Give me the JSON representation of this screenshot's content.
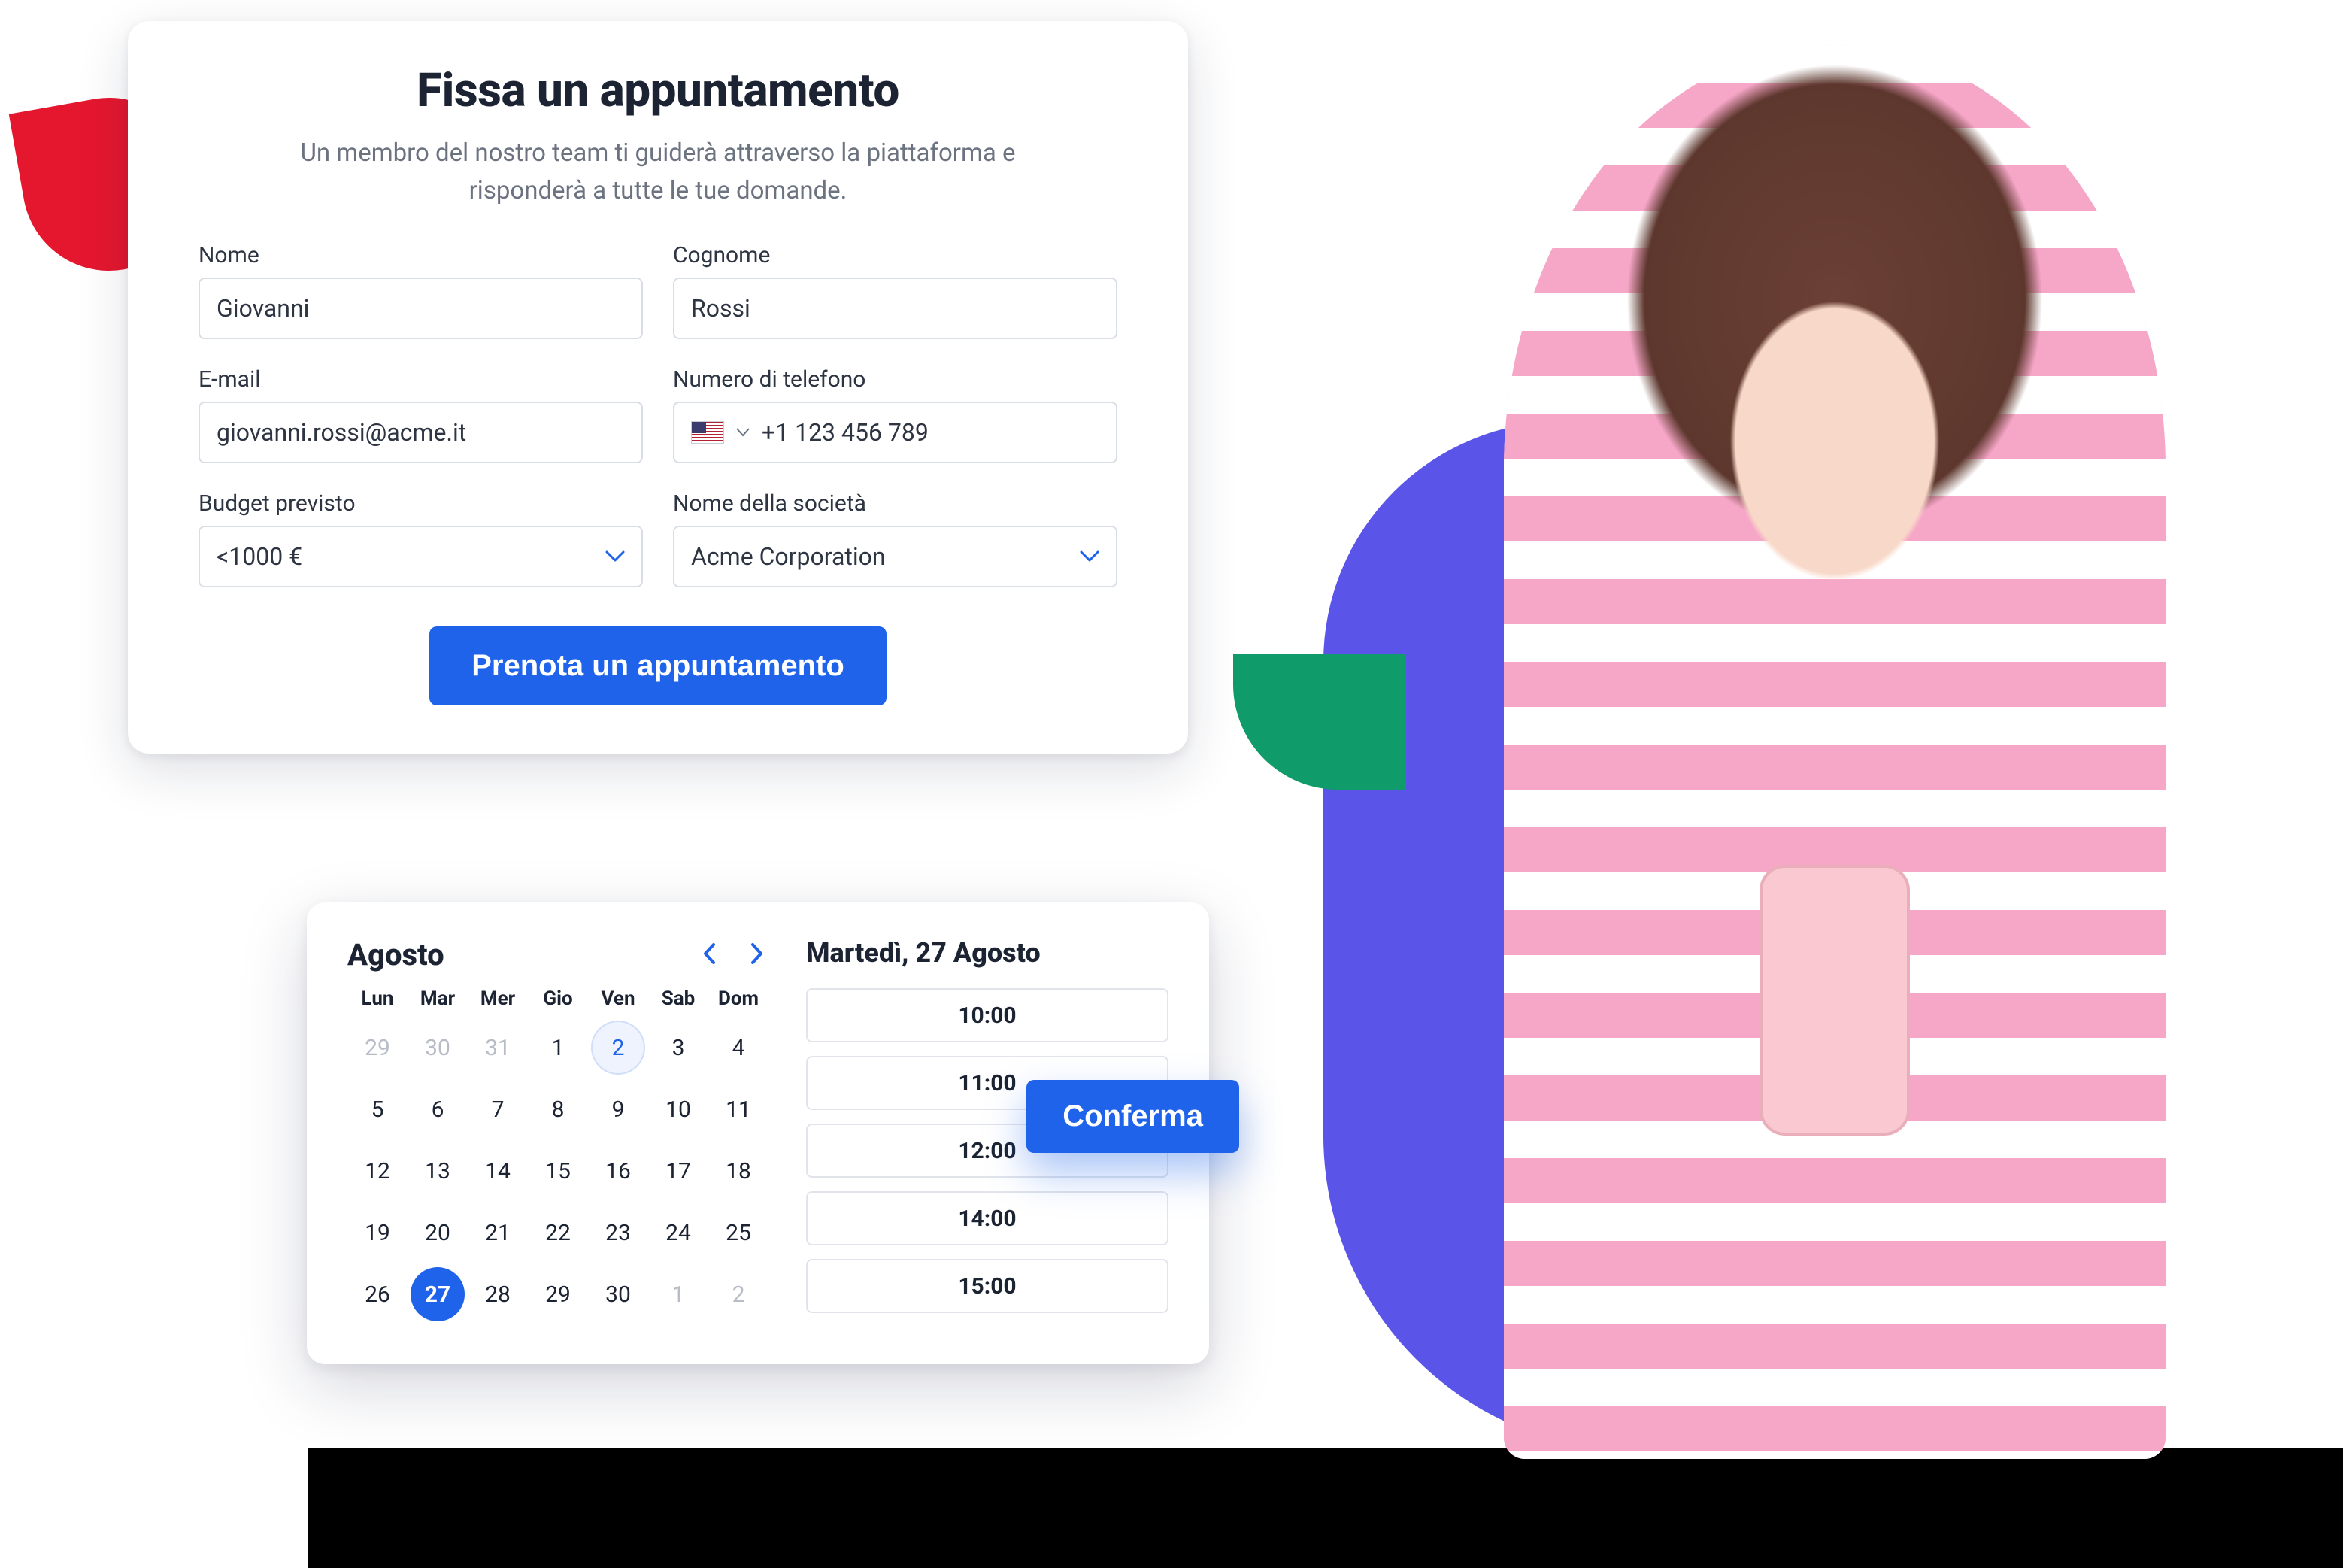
{
  "colors": {
    "accent": "#1e63e9",
    "red": "#e5172f",
    "green": "#0f9b6a",
    "purple": "#5b54e8"
  },
  "form": {
    "title": "Fissa un appuntamento",
    "subtitle": "Un membro del nostro team ti guiderà attraverso la piattaforma e risponderà a tutte le tue domande.",
    "fields": {
      "first_name": {
        "label": "Nome",
        "value": "Giovanni"
      },
      "last_name": {
        "label": "Cognome",
        "value": "Rossi"
      },
      "email": {
        "label": "E-mail",
        "value": "giovanni.rossi@acme.it"
      },
      "phone": {
        "label": "Numero di telefono",
        "value": "+1 123 456 789",
        "flag": "us"
      },
      "budget": {
        "label": "Budget previsto",
        "value": "<1000 €"
      },
      "company": {
        "label": "Nome della società",
        "value": "Acme Corporation"
      }
    },
    "submit_label": "Prenota un appuntamento"
  },
  "calendar": {
    "month_label": "Agosto",
    "dow": [
      "Lun",
      "Mar",
      "Mer",
      "Gio",
      "Ven",
      "Sab",
      "Dom"
    ],
    "days": [
      {
        "n": 29,
        "muted": true
      },
      {
        "n": 30,
        "muted": true
      },
      {
        "n": 31,
        "muted": true
      },
      {
        "n": 1
      },
      {
        "n": 2,
        "today": true
      },
      {
        "n": 3
      },
      {
        "n": 4
      },
      {
        "n": 5
      },
      {
        "n": 6
      },
      {
        "n": 7
      },
      {
        "n": 8
      },
      {
        "n": 9
      },
      {
        "n": 10
      },
      {
        "n": 11
      },
      {
        "n": 12
      },
      {
        "n": 13
      },
      {
        "n": 14
      },
      {
        "n": 15
      },
      {
        "n": 16
      },
      {
        "n": 17
      },
      {
        "n": 18
      },
      {
        "n": 19
      },
      {
        "n": 20
      },
      {
        "n": 21
      },
      {
        "n": 22
      },
      {
        "n": 23
      },
      {
        "n": 24
      },
      {
        "n": 25
      },
      {
        "n": 26
      },
      {
        "n": 27,
        "selected": true
      },
      {
        "n": 28
      },
      {
        "n": 29
      },
      {
        "n": 30
      },
      {
        "n": 1,
        "muted": true
      },
      {
        "n": 2,
        "muted": true
      }
    ],
    "selected_label": "Martedì, 27 Agosto",
    "slots": [
      "10:00",
      "11:00",
      "12:00",
      "14:00",
      "15:00"
    ],
    "confirm_label": "Conferma"
  }
}
